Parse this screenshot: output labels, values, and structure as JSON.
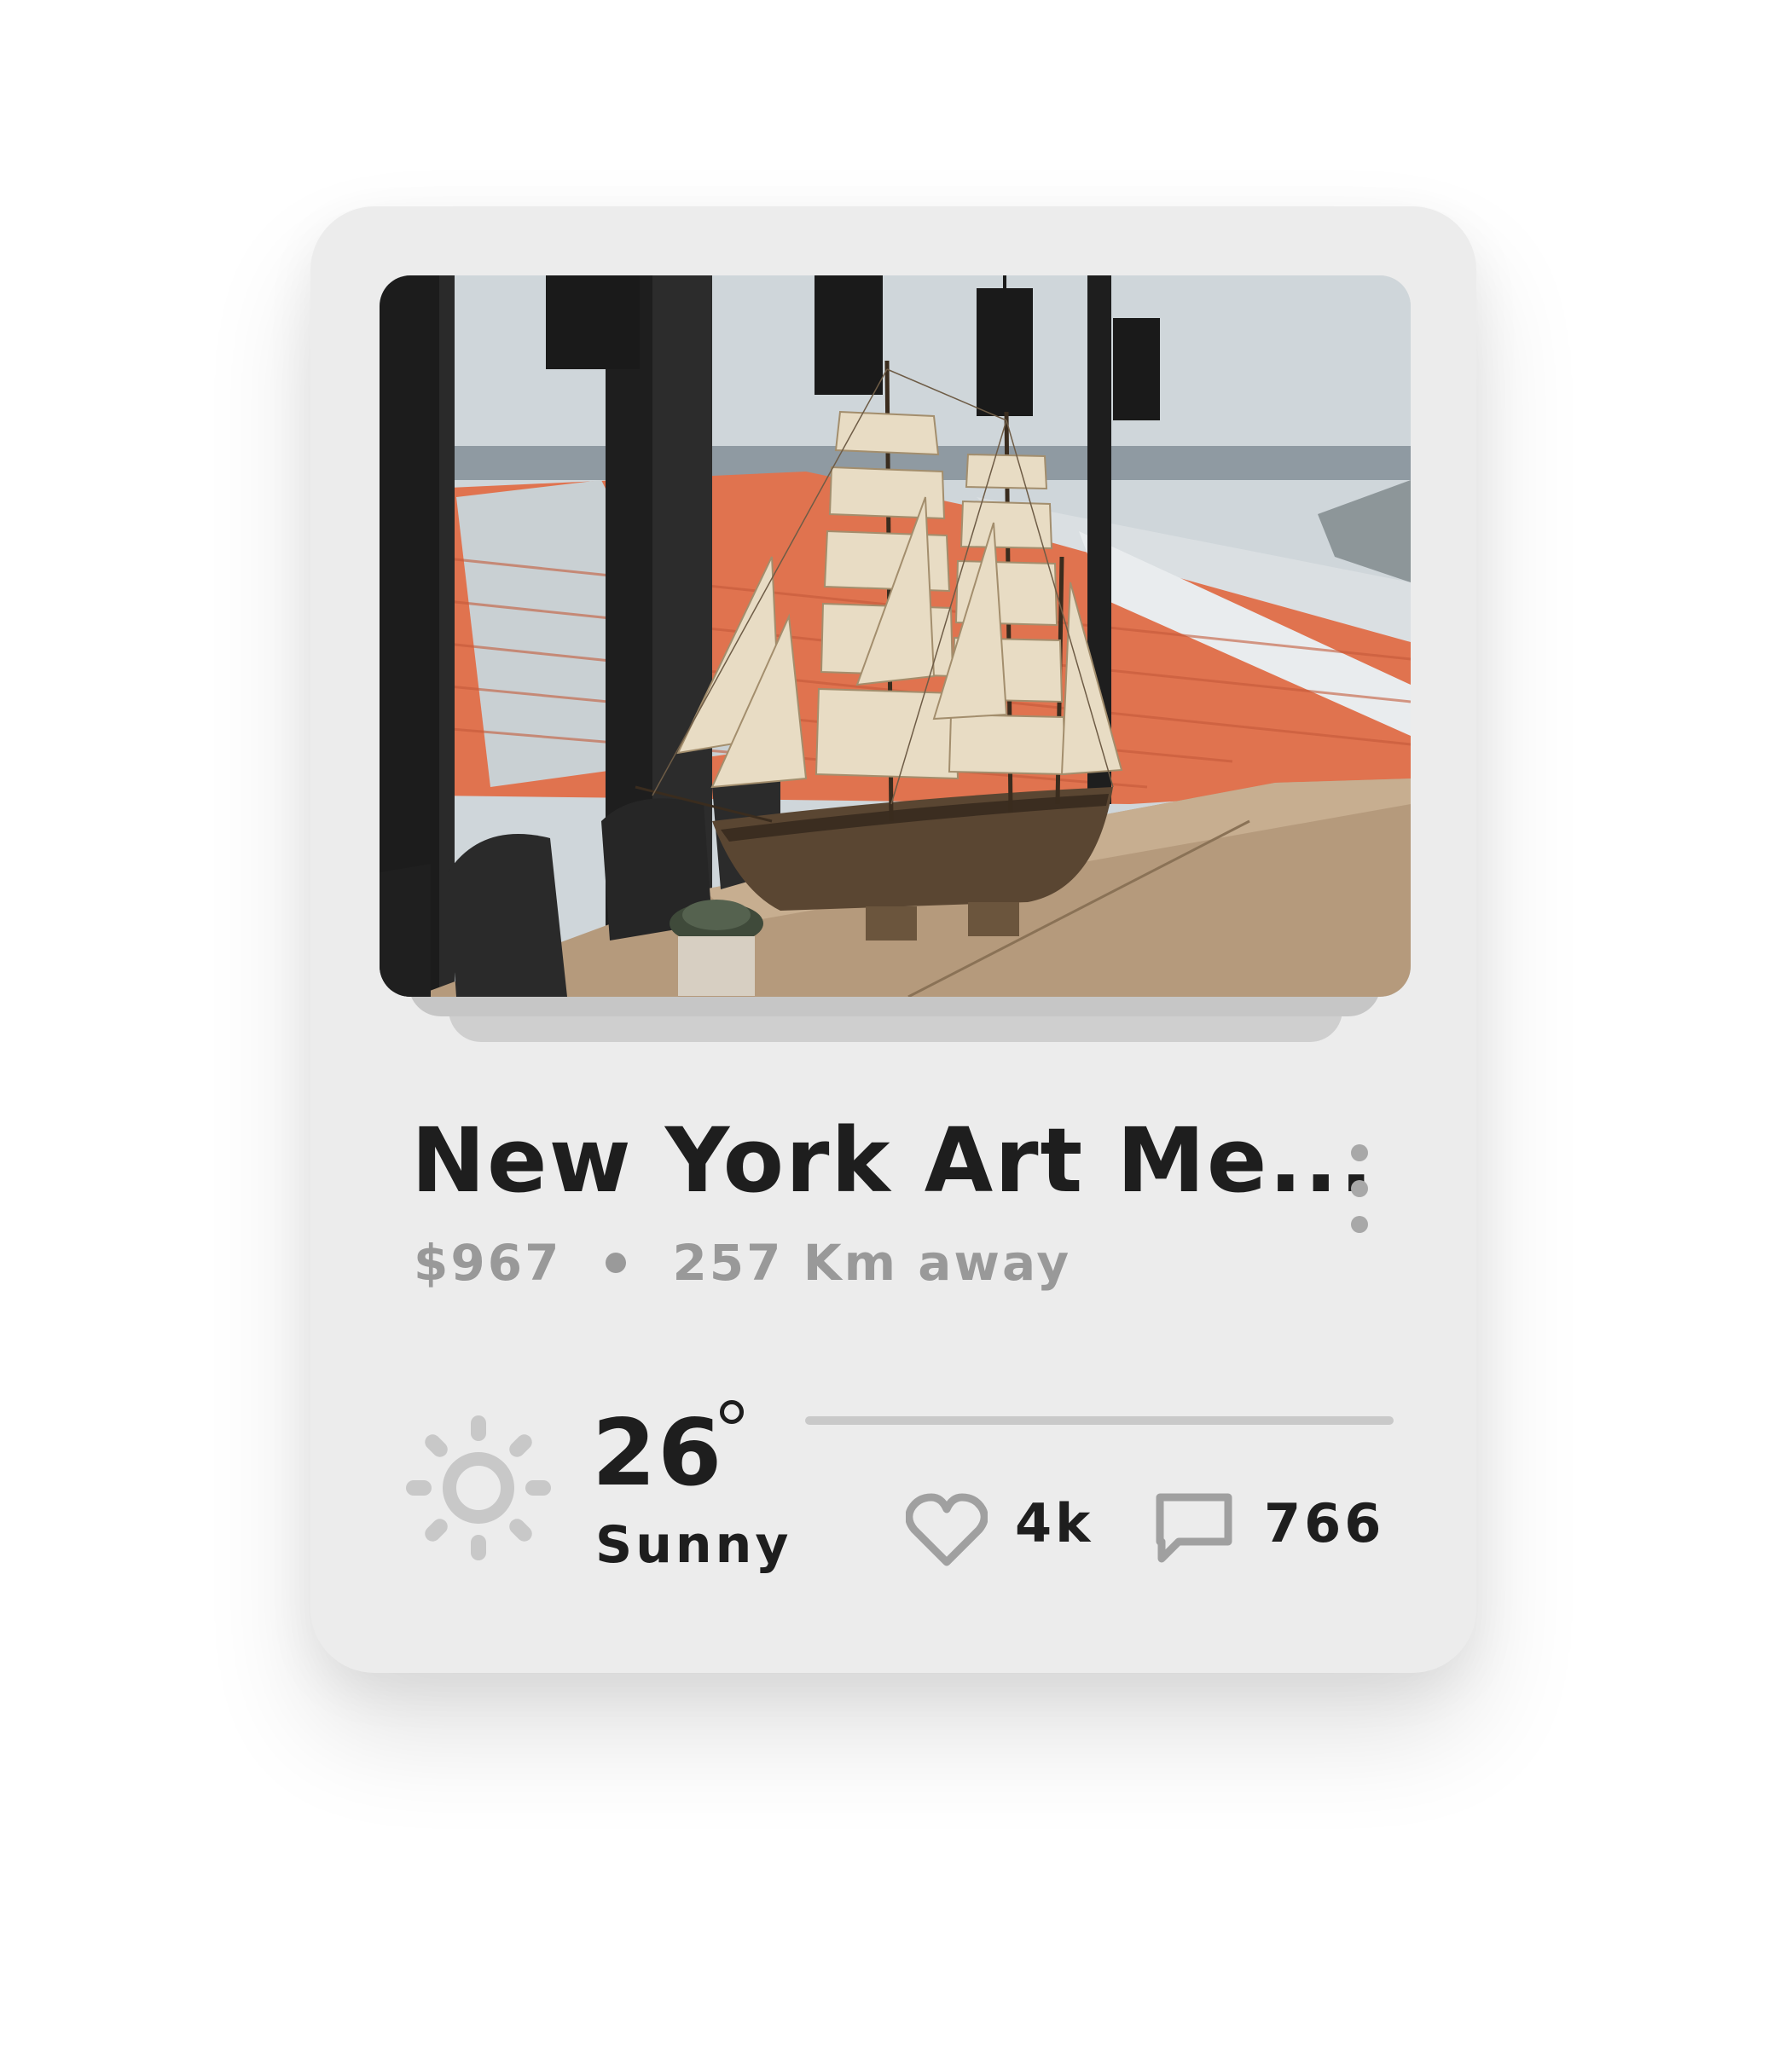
{
  "card": {
    "title": "New York Art Me...",
    "price": "$967",
    "distance": "257 Km away",
    "photo_subject": "model ship on wooden table by window with orange rooftops",
    "more_icon": "more-vertical-icon"
  },
  "weather": {
    "temperature": "26",
    "condition": "Sunny",
    "icon": "sun-icon"
  },
  "stats": {
    "likes": "4k",
    "like_icon": "heart-icon",
    "comments": "766",
    "comment_icon": "comment-icon"
  },
  "colors": {
    "card_background": "#ececec",
    "title": "#1e1e1e",
    "meta": "#999999",
    "icon_gray": "#a8a8a8",
    "divider": "#c9c9c9"
  }
}
